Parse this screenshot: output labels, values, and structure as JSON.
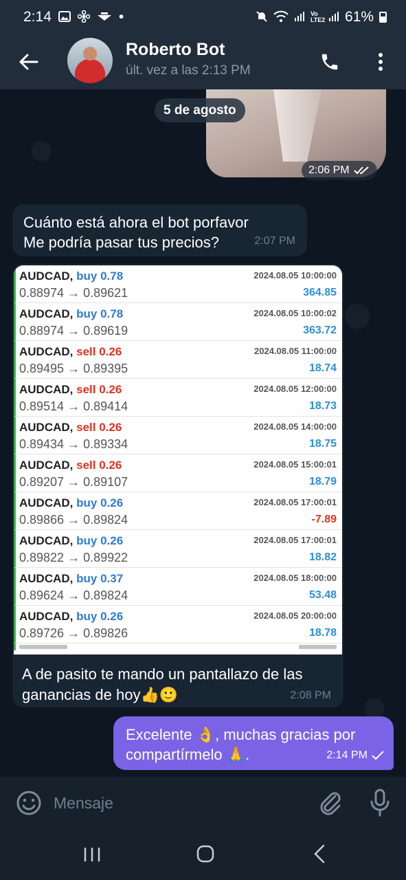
{
  "status_bar": {
    "time": "2:14",
    "dot": "•",
    "battery_percent": "61%",
    "network_label": "Vo LTE2",
    "icons": [
      "image-icon",
      "pinwheel-icon",
      "plane-logo-icon",
      "mute-icon",
      "wifi-icon",
      "signal-icon",
      "battery-icon"
    ]
  },
  "header": {
    "back_icon": "arrow-left-icon",
    "contact_name": "Roberto Bot",
    "contact_status": "últ. vez a las 2:13 PM",
    "call_icon": "phone-icon",
    "menu_icon": "more-vertical-icon"
  },
  "chat": {
    "date_separator": "5 de agosto",
    "image_message": {
      "time": "2:06 PM",
      "status_icon": "double-check-icon"
    },
    "message1": {
      "line1": "Cuánto está ahora el bot porfavor",
      "line2": "Me podría pasar tus precios?",
      "time": "2:07 PM"
    },
    "trade_message": {
      "caption_line1": "A de pasito te mando un pantallazo de las",
      "caption_line2": "ganancias de hoy👍🙂",
      "time": "2:08 PM"
    },
    "trades": [
      {
        "pair": "AUDCAD,",
        "side": "buy 0.78",
        "prices": "0.88974 → 0.89621",
        "date": "2024.08.05 10:00:00",
        "profit": "364.85"
      },
      {
        "pair": "AUDCAD,",
        "side": "buy 0.78",
        "prices": "0.88974 → 0.89619",
        "date": "2024.08.05 10:00:02",
        "profit": "363.72"
      },
      {
        "pair": "AUDCAD,",
        "side": "sell 0.26",
        "prices": "0.89495 → 0.89395",
        "date": "2024.08.05 11:00:00",
        "profit": "18.74"
      },
      {
        "pair": "AUDCAD,",
        "side": "sell 0.26",
        "prices": "0.89514 → 0.89414",
        "date": "2024.08.05 12:00:00",
        "profit": "18.73"
      },
      {
        "pair": "AUDCAD,",
        "side": "sell 0.26",
        "prices": "0.89434 → 0.89334",
        "date": "2024.08.05 14:00:00",
        "profit": "18.75"
      },
      {
        "pair": "AUDCAD,",
        "side": "sell 0.26",
        "prices": "0.89207 → 0.89107",
        "date": "2024.08.05 15:00:01",
        "profit": "18.79"
      },
      {
        "pair": "AUDCAD,",
        "side": "buy 0.26",
        "prices": "0.89866 → 0.89824",
        "date": "2024.08.05 17:00:01",
        "profit": "-7.89"
      },
      {
        "pair": "AUDCAD,",
        "side": "buy 0.26",
        "prices": "0.89822 → 0.89922",
        "date": "2024.08.05 17:00:01",
        "profit": "18.82"
      },
      {
        "pair": "AUDCAD,",
        "side": "buy 0.37",
        "prices": "0.89624 → 0.89824",
        "date": "2024.08.05 18:00:00",
        "profit": "53.48"
      },
      {
        "pair": "AUDCAD,",
        "side": "buy 0.26",
        "prices": "0.89726 → 0.89826",
        "date": "2024.08.05 20:00:00",
        "profit": "18.78"
      }
    ],
    "outgoing": {
      "line1": "Excelente 👌, muchas gracias por",
      "line2": "compartírmelo 🙏.",
      "time": "2:14 PM",
      "status_icon": "check-icon"
    }
  },
  "input_bar": {
    "placeholder": "Mensaje",
    "emoji_icon": "smiley-icon",
    "attach_icon": "paperclip-icon",
    "mic_icon": "microphone-icon"
  },
  "nav_bar": {
    "recents_icon": "recents-icon",
    "home_icon": "home-icon",
    "back_icon": "back-chevron-icon"
  },
  "colors": {
    "header_bg": "#212d3b",
    "chat_bg": "#0e1621",
    "incoming_bubble": "#182533",
    "outgoing_bubble": "#7b63e6",
    "buy": "#2b7bd6",
    "sell": "#e0321f",
    "profit_positive": "#2b8fd8",
    "profit_negative": "#e0321f",
    "trade_border": "#3bb54a"
  }
}
